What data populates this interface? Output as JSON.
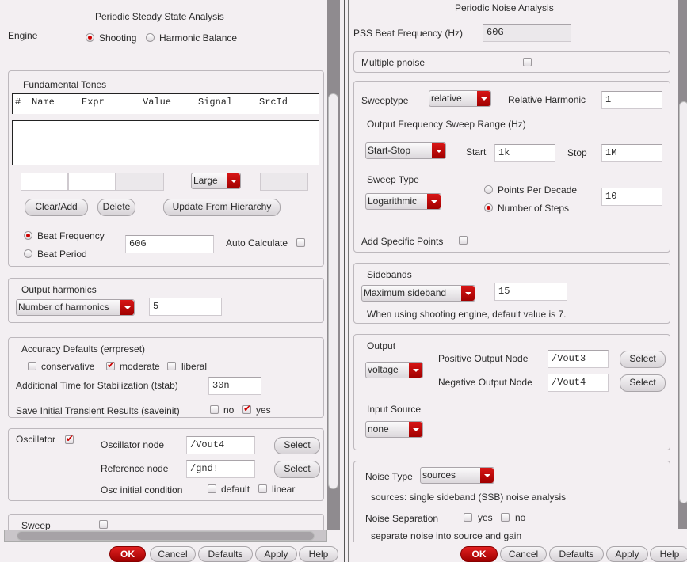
{
  "pss": {
    "title": "Periodic Steady State Analysis",
    "engine_label": "Engine",
    "engine_options": [
      "Shooting",
      "Harmonic Balance"
    ],
    "engine_selected": "Shooting",
    "tones": {
      "title": "Fundamental Tones",
      "columns": [
        "#",
        "Name",
        "Expr",
        "Value",
        "Signal",
        "SrcId"
      ],
      "rows": [],
      "size_value": "Large",
      "buttons": {
        "clear_add": "Clear/Add",
        "delete": "Delete",
        "update": "Update From Hierarchy"
      }
    },
    "beat": {
      "frequency_label": "Beat Frequency",
      "period_label": "Beat Period",
      "selected": "Beat Frequency",
      "value": "60G",
      "auto_calc_label": "Auto Calculate",
      "auto_calc": false
    },
    "harmonics": {
      "title": "Output harmonics",
      "mode": "Number of harmonics",
      "value": "5"
    },
    "accuracy": {
      "title": "Accuracy Defaults (errpreset)",
      "options": [
        {
          "label": "conservative",
          "checked": false
        },
        {
          "label": "moderate",
          "checked": true
        },
        {
          "label": "liberal",
          "checked": false
        }
      ],
      "tstab_label": "Additional Time for Stabilization (tstab)",
      "tstab": "30n",
      "saveinit_label": "Save Initial Transient Results (saveinit)",
      "saveinit_no": "no",
      "saveinit_yes": "yes",
      "saveinit": "yes"
    },
    "oscillator": {
      "label": "Oscillator",
      "checked": true,
      "osc_node_label": "Oscillator node",
      "osc_node": "/Vout4",
      "ref_node_label": "Reference node",
      "ref_node": "/gnd!",
      "select": "Select",
      "init_label": "Osc initial condition",
      "init_default": "default",
      "init_linear": "linear"
    },
    "sweep": {
      "label": "Sweep",
      "checked": false
    }
  },
  "pnoise": {
    "title": "Periodic Noise Analysis",
    "pss_beat_label": "PSS Beat Frequency (Hz)",
    "pss_beat": "60G",
    "multiple_label": "Multiple pnoise",
    "multiple": false,
    "sweeptype_label": "Sweeptype",
    "sweeptype": "relative",
    "rel_harm_label": "Relative Harmonic",
    "rel_harm": "1",
    "range_label": "Output Frequency Sweep Range (Hz)",
    "range_mode": "Start-Stop",
    "start_label": "Start",
    "start": "1k",
    "stop_label": "Stop",
    "stop": "1M",
    "sweep_type_label": "Sweep Type",
    "sweep_type": "Logarithmic",
    "ppd_label": "Points Per Decade",
    "steps_label": "Number of Steps",
    "steps_selected": "Number of Steps",
    "steps": "10",
    "add_points_label": "Add Specific Points",
    "sidebands_label": "Sidebands",
    "sidebands_mode": "Maximum sideband",
    "sidebands": "15",
    "sidebands_note": "When using shooting engine, default value is 7.",
    "output_label": "Output",
    "output": "voltage",
    "pos_label": "Positive Output Node",
    "pos": "/Vout3",
    "neg_label": "Negative Output Node",
    "neg": "/Vout4",
    "select": "Select",
    "input_source_label": "Input Source",
    "input_source": "none",
    "noise_type_label": "Noise Type",
    "noise_type": "sources",
    "noise_note": "sources: single sideband (SSB) noise analysis",
    "sep_label": "Noise Separation",
    "sep_yes": "yes",
    "sep_no": "no",
    "sep_note": "separate noise into source and gain"
  },
  "buttons": {
    "ok": "OK",
    "cancel": "Cancel",
    "defaults": "Defaults",
    "apply": "Apply",
    "help": "Help"
  },
  "colors": {
    "accent": "#c00000",
    "panel": "#f3eff2"
  }
}
